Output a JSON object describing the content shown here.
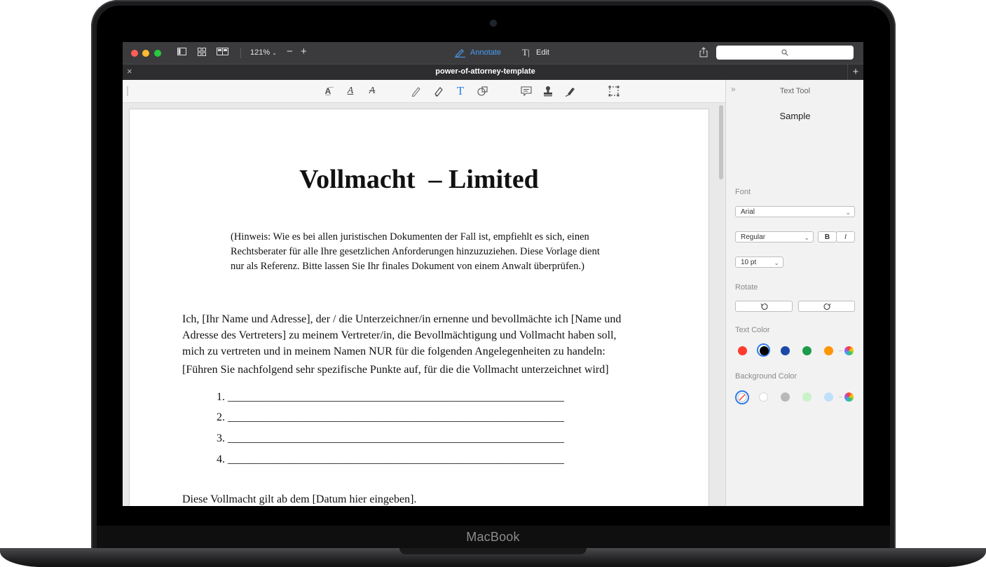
{
  "device": {
    "brand": "MacBook"
  },
  "window": {
    "zoom": "121%",
    "mode_annotate": "Annotate",
    "mode_edit": "Edit"
  },
  "tab": {
    "title": "power-of-attorney-template"
  },
  "document": {
    "title": "Vollmacht  – Limited",
    "note_lines": [
      "(Hinweis: Wie es bei allen juristischen Dokumenten der Fall ist, empfiehlt es sich, einen",
      "Rechtsberater für alle Ihre gesetzlichen Anforderungen hinzuzuziehen. Diese Vorlage dient",
      "nur als Referenz. Bitte lassen Sie Ihr finales Dokument von einem Anwalt überprüfen.)"
    ],
    "body_lines": [
      "Ich, [Ihr Name und Adresse], der / die Unterzeichner/in ernenne und bevollmächte ich [Name und",
      "Adresse des Vertreters] zu meinem Vertreter/in, die Bevollmächtigung und Vollmacht haben soll,",
      "mich zu vertreten und in meinem Namen NUR für die folgenden Angelegenheiten zu handeln:"
    ],
    "instruction": "[Führen Sie nachfolgend sehr spezifische Punkte auf, für die die Vollmacht unterzeichnet wird]",
    "list_items": [
      "1. ____________________________________________________________",
      "2. ____________________________________________________________",
      "3. ____________________________________________________________",
      "4. ____________________________________________________________"
    ],
    "validity": "Diese Vollmacht gilt ab dem [Datum hier eingeben]."
  },
  "panel": {
    "title": "Text Tool",
    "sample": "Sample",
    "font_label": "Font",
    "font": "Arial",
    "style": "Regular",
    "bold": "B",
    "italic": "I",
    "size": "10 pt",
    "rotate_label": "Rotate",
    "text_color_label": "Text Color",
    "text_colors": [
      "#ff3b30",
      "#000000",
      "#1a4aa8",
      "#1e9a4a",
      "#ff9500"
    ],
    "bg_color_label": "Background Color",
    "bg_colors": [
      "#ffffff",
      "#b8b8b8",
      "#c8f2c8",
      "#bfe0fb"
    ]
  }
}
